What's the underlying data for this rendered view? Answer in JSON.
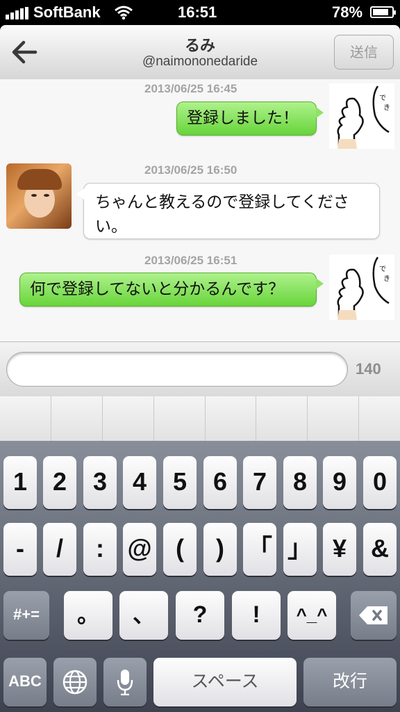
{
  "status": {
    "carrier": "SoftBank",
    "time": "16:51",
    "battery": "78%"
  },
  "header": {
    "name": "るみ",
    "handle": "@naimononedaride",
    "send_label": "送信"
  },
  "messages": [
    {
      "timestamp": "2013/06/25 16:45",
      "text": "登録しました！",
      "side": "right"
    },
    {
      "timestamp": "2013/06/25 16:50",
      "text": "ちゃんと教えるので登録してください。",
      "side": "left"
    },
    {
      "timestamp": "2013/06/25 16:51",
      "text": "何で登録してないと分かるんです？",
      "side": "right"
    }
  ],
  "input": {
    "value": "",
    "char_count": "140"
  },
  "keyboard": {
    "row1": [
      "1",
      "2",
      "3",
      "4",
      "5",
      "6",
      "7",
      "8",
      "9",
      "0"
    ],
    "row2": [
      "-",
      "/",
      ":",
      "@",
      "(",
      ")",
      "「",
      "」",
      "¥",
      "&"
    ],
    "row3": [
      "#+=",
      "。",
      "、",
      "?",
      "!",
      "^_^"
    ],
    "row4": {
      "abc": "ABC",
      "space": "スペース",
      "return": "改行"
    }
  },
  "colors": {
    "outgoing_bubble": "#7fdc55",
    "background": "#f7f7f7"
  }
}
